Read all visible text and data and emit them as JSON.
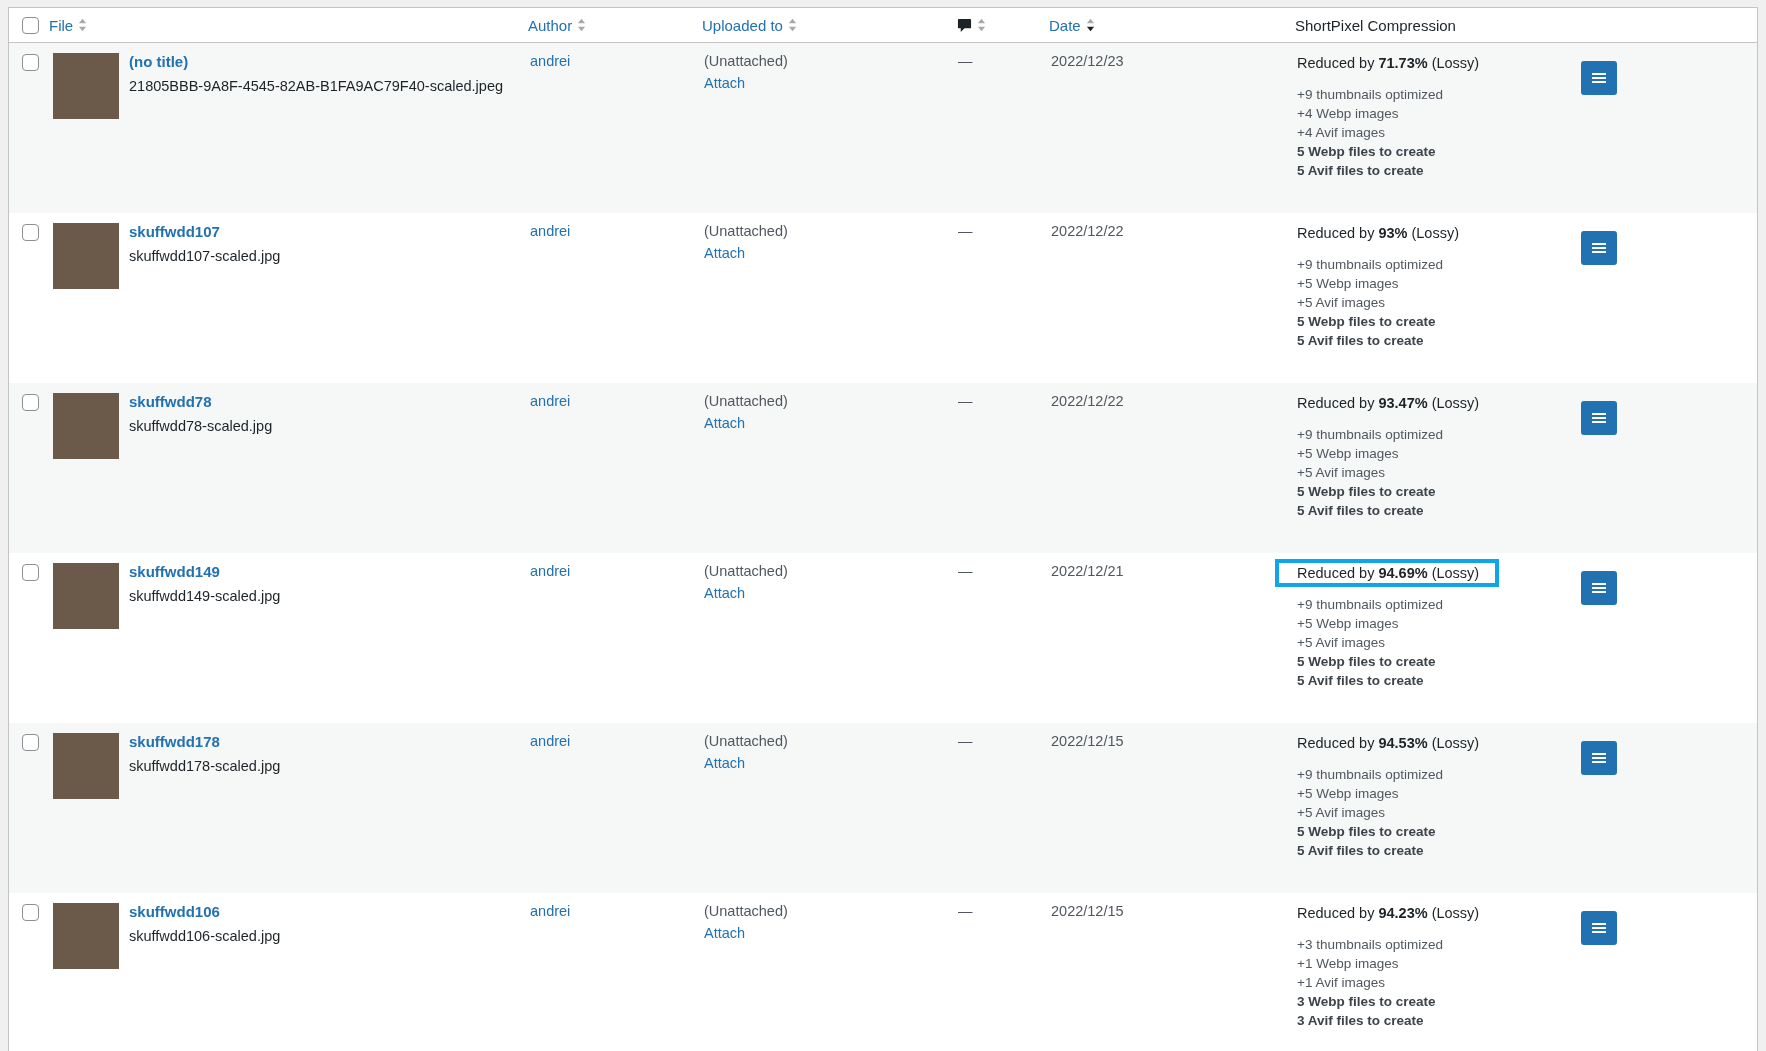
{
  "table": {
    "select_all": {
      "checked": false
    },
    "columns": [
      {
        "label": "File",
        "kind": "sortable",
        "sorted": false
      },
      {
        "label": "Author",
        "kind": "sortable",
        "sorted": false
      },
      {
        "label": "Uploaded to",
        "kind": "sortable",
        "sorted": false
      },
      {
        "kind": "comments",
        "sorted": false
      },
      {
        "label": "Date",
        "kind": "sortable",
        "sorted": true
      },
      {
        "label": "ShortPixel Compression",
        "kind": "plain"
      }
    ],
    "rows": [
      {
        "checked": false,
        "title": "(no title)",
        "filename": "21805BBB-9A8F-4545-82AB-B1FA9AC79F40-scaled.jpeg",
        "author": "andrei",
        "uploaded_to": "(Unattached)",
        "attach": "Attach",
        "comments": "—",
        "date": "2022/12/23",
        "reduced": "Reduced by **71.73%** (Lossy)",
        "highlighted": false,
        "stats": [
          {
            "text": "+9 thumbnails optimized",
            "kind": "done"
          },
          {
            "text": "+4 Webp images",
            "kind": "done"
          },
          {
            "text": "+4 Avif images",
            "kind": "done"
          },
          {
            "text": "5 Webp files to create",
            "kind": "pending"
          },
          {
            "text": "5 Avif files to create",
            "kind": "pending"
          }
        ]
      },
      {
        "checked": false,
        "title": "skuffwdd107",
        "filename": "skuffwdd107-scaled.jpg",
        "author": "andrei",
        "uploaded_to": "(Unattached)",
        "attach": "Attach",
        "comments": "—",
        "date": "2022/12/22",
        "reduced": "Reduced by **93%** (Lossy)",
        "highlighted": false,
        "stats": [
          {
            "text": "+9 thumbnails optimized",
            "kind": "done"
          },
          {
            "text": "+5 Webp images",
            "kind": "done"
          },
          {
            "text": "+5 Avif images",
            "kind": "done"
          },
          {
            "text": "5 Webp files to create",
            "kind": "pending"
          },
          {
            "text": "5 Avif files to create",
            "kind": "pending"
          }
        ]
      },
      {
        "checked": false,
        "title": "skuffwdd78",
        "filename": "skuffwdd78-scaled.jpg",
        "author": "andrei",
        "uploaded_to": "(Unattached)",
        "attach": "Attach",
        "comments": "—",
        "date": "2022/12/22",
        "reduced": "Reduced by **93.47%** (Lossy)",
        "highlighted": false,
        "stats": [
          {
            "text": "+9 thumbnails optimized",
            "kind": "done"
          },
          {
            "text": "+5 Webp images",
            "kind": "done"
          },
          {
            "text": "+5 Avif images",
            "kind": "done"
          },
          {
            "text": "5 Webp files to create",
            "kind": "pending"
          },
          {
            "text": "5 Avif files to create",
            "kind": "pending"
          }
        ]
      },
      {
        "checked": false,
        "title": "skuffwdd149",
        "filename": "skuffwdd149-scaled.jpg",
        "author": "andrei",
        "uploaded_to": "(Unattached)",
        "attach": "Attach",
        "comments": "—",
        "date": "2022/12/21",
        "reduced": "Reduced by **94.69%** (Lossy)",
        "highlighted": true,
        "stats": [
          {
            "text": "+9 thumbnails optimized",
            "kind": "done"
          },
          {
            "text": "+5 Webp images",
            "kind": "done"
          },
          {
            "text": "+5 Avif images",
            "kind": "done"
          },
          {
            "text": "5 Webp files to create",
            "kind": "pending"
          },
          {
            "text": "5 Avif files to create",
            "kind": "pending"
          }
        ]
      },
      {
        "checked": false,
        "title": "skuffwdd178",
        "filename": "skuffwdd178-scaled.jpg",
        "author": "andrei",
        "uploaded_to": "(Unattached)",
        "attach": "Attach",
        "comments": "—",
        "date": "2022/12/15",
        "reduced": "Reduced by **94.53%** (Lossy)",
        "highlighted": false,
        "stats": [
          {
            "text": "+9 thumbnails optimized",
            "kind": "done"
          },
          {
            "text": "+5 Webp images",
            "kind": "done"
          },
          {
            "text": "+5 Avif images",
            "kind": "done"
          },
          {
            "text": "5 Webp files to create",
            "kind": "pending"
          },
          {
            "text": "5 Avif files to create",
            "kind": "pending"
          }
        ]
      },
      {
        "checked": false,
        "title": "skuffwdd106",
        "filename": "skuffwdd106-scaled.jpg",
        "author": "andrei",
        "uploaded_to": "(Unattached)",
        "attach": "Attach",
        "comments": "—",
        "date": "2022/12/15",
        "reduced": "Reduced by **94.23%** (Lossy)",
        "highlighted": false,
        "stats": [
          {
            "text": "+3 thumbnails optimized",
            "kind": "done"
          },
          {
            "text": "+1 Webp images",
            "kind": "done"
          },
          {
            "text": "+1 Avif images",
            "kind": "done"
          },
          {
            "text": "3 Webp files to create",
            "kind": "pending"
          },
          {
            "text": "3 Avif files to create",
            "kind": "pending"
          }
        ]
      }
    ]
  }
}
